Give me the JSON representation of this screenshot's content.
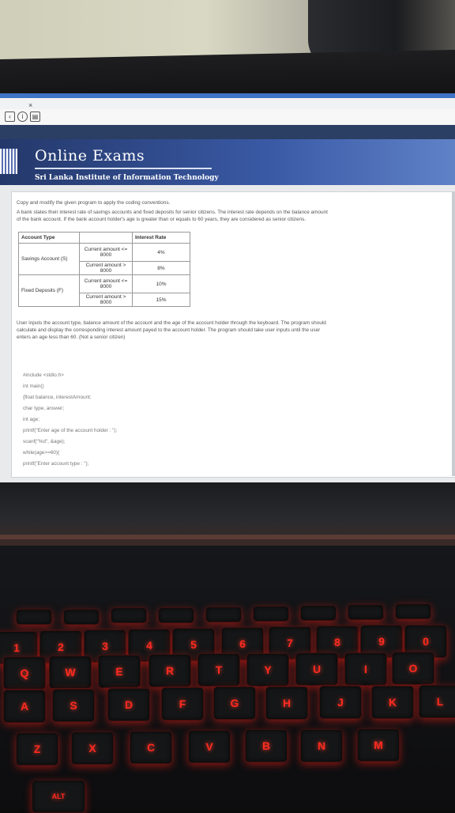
{
  "browser": {
    "close_glyph": "×"
  },
  "header": {
    "title": "Online Exams",
    "subtitle": "Sri Lanka Institute of Information Technology"
  },
  "question": {
    "line1": "Copy and modify the given program to apply the coding conventions.",
    "line2": "A bank states their interest rate of savings accounts and fixed deposits for senior citizens. The interest rate depends on the balance amount",
    "line3": "of the bank account. If the bank account holder's age is greater than or equals to 60 years, they are considered as senior citizens.",
    "table": {
      "headers": [
        "Account Type",
        "",
        "Interest Rate"
      ],
      "rows": [
        {
          "type": "Savings Account (S)",
          "condition": "Current amount <= 8000",
          "rate": "4%"
        },
        {
          "type": "",
          "condition": "Current amount > 8000",
          "rate": "8%"
        },
        {
          "type": "Fixed Deposits (F)",
          "condition": "Current amount <= 8000",
          "rate": "10%"
        },
        {
          "type": "",
          "condition": "Current amount > 8000",
          "rate": "15%"
        }
      ]
    },
    "para1": "User inputs the account type, balance amount of the account and the age of the account holder through the keyboard. The program should",
    "para2": "calculate and display the corresponding interest amount payed to the account holder.  The program should take user inputs until the user",
    "para3": "enters an age less than 60. (Not a senior citizen)",
    "code": [
      "#include <stdio.h>",
      "int main()",
      "{float balance, interestAmount;",
      "char type, answer;",
      "int age;",
      "printf(\"Enter age of the account holder : \");",
      "scanf(\"%d\", &age);",
      "while(age>=60){",
      "printf(\"Enter account type : \");"
    ]
  },
  "keyboard": {
    "row1": [
      "1",
      "2",
      "3",
      "4",
      "5",
      "6",
      "7",
      "8",
      "9",
      "0"
    ],
    "row2": [
      "Q",
      "W",
      "E",
      "R",
      "T",
      "Y",
      "U",
      "I",
      "O"
    ],
    "row3": [
      "A",
      "S",
      "D",
      "F",
      "G",
      "H",
      "J",
      "K",
      "L"
    ],
    "row4": [
      "Z",
      "X",
      "C",
      "V",
      "B",
      "N",
      "M"
    ],
    "alt": "ALT"
  },
  "colors": {
    "header_blue": "#3a5aa6",
    "key_glow": "#ff2a1f"
  }
}
